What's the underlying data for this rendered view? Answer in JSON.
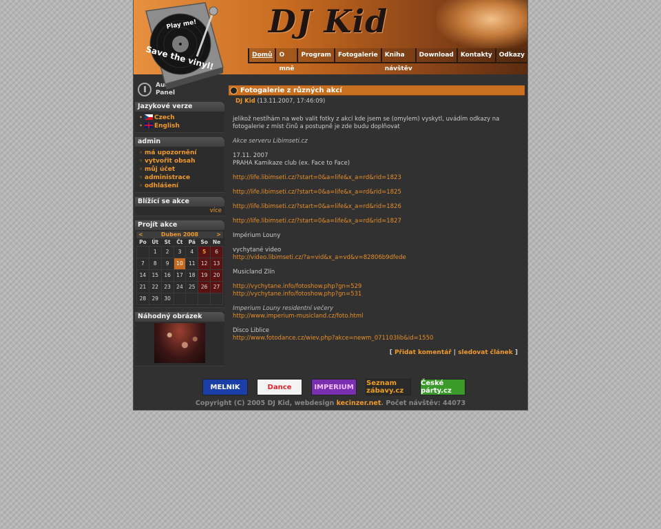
{
  "header": {
    "logo": "DJ Kid",
    "turntable_text_top": "Play me!",
    "turntable_text_bottom": "Save the vinyl!"
  },
  "nav": [
    {
      "label": "Domů",
      "active": true
    },
    {
      "label": "O mně"
    },
    {
      "label": "Program"
    },
    {
      "label": "Fotogalerie"
    },
    {
      "label": "Kniha návštěv"
    },
    {
      "label": "Download"
    },
    {
      "label": "Kontakty"
    },
    {
      "label": "Odkazy"
    }
  ],
  "sidebar": {
    "audio_panel": {
      "line1": "Audio",
      "line2": "Panel"
    },
    "languages": {
      "title": "Jazykové verze",
      "items": [
        "Czech",
        "English"
      ]
    },
    "admin": {
      "title": "admin",
      "items": [
        "má upozornění",
        "vytvořit obsah",
        "můj účet",
        "administrace",
        "odhlášení"
      ]
    },
    "upcoming": {
      "title": "Blížící se akce",
      "more": "více"
    },
    "browse": {
      "title": "Projít akce",
      "month": "Duben 2008",
      "prev": "<",
      "next": ">",
      "weekdays": [
        "Po",
        "Út",
        "St",
        "Čt",
        "Pá",
        "So",
        "Ne"
      ],
      "weeks": [
        [
          "",
          "1",
          "2",
          "3",
          "4",
          "5",
          "6"
        ],
        [
          "7",
          "8",
          "9",
          "10",
          "11",
          "12",
          "13"
        ],
        [
          "14",
          "15",
          "16",
          "17",
          "18",
          "19",
          "20"
        ],
        [
          "21",
          "22",
          "23",
          "24",
          "25",
          "26",
          "27"
        ],
        [
          "28",
          "29",
          "30",
          "",
          "",
          "",
          ""
        ]
      ]
    },
    "random": {
      "title": "Náhodný obrázek"
    }
  },
  "article": {
    "title": "Fotogalerie z různých akcí",
    "author": "DJ Kid",
    "date": "(13.11.2007, 17:46:09)",
    "intro": "jelikož nestíhám na web valit fotky z akcí kde jsem se (omylem) vyskytl, uvádím odkazy na fotogalerie z míst činů a postupně je zde budu doplňovat",
    "section1": "Akce serveru Libimseti.cz",
    "date1": "17.11. 2007",
    "venue1": "PRAHA Kamikaze club (ex. Face to Face)",
    "links1": [
      "http://life.libimseti.cz/?start=0&a=life&x_a=rd&rid=1823",
      "http://life.libimseti.cz/?start=0&a=life&x_a=rd&rid=1825",
      "http://life.libimseti.cz/?start=0&a=life&x_a=rd&rid=1826",
      "http://life.libimseti.cz/?start=0&a=life&x_a=rd&rid=1827"
    ],
    "imperium": "Impérium Louny",
    "video_label": "vychytané video",
    "video_link": "http://video.libimseti.cz/?a=vid&x_a=vd&v=82806b9dfede",
    "musicland": "Musicland Zlín",
    "vych1": "http://vychytane.info/fotoshow.php?gn=529",
    "vych2": "http://vychytane.info/fotoshow.php?gn=531",
    "imperium2": "Imperium Louny residentní večery",
    "imperium_link": "http://www.imperium-musicland.cz/foto.html",
    "disco": "Disco Liblice",
    "disco_link": "http://www.fotodance.cz/wiev.php?akce=newm_071103lib&id=1550",
    "add_comment": "Přidat komentář",
    "watch": "sledovat článek"
  },
  "banners": [
    {
      "label": "MELNIK",
      "bg": "#1a3fa8",
      "fg": "#ffffff"
    },
    {
      "label": "Dance",
      "bg": "#f3f3f3",
      "fg": "#e0202a"
    },
    {
      "label": "IMPERIUM",
      "bg": "#7a2fb0",
      "fg": "#f0c0ff"
    },
    {
      "label": "Seznam zábavy.cz",
      "bg": "#2a2a2a",
      "fg": "#f0a020"
    },
    {
      "label": "České párty.cz",
      "bg": "#3a9a2a",
      "fg": "#ffffff"
    }
  ],
  "footer": {
    "copyright": "Copyright (C) 2005 DJ Kid, webdesign",
    "designer": "kecinzer.net",
    "visits": ". Počet návštěv: 44073"
  }
}
